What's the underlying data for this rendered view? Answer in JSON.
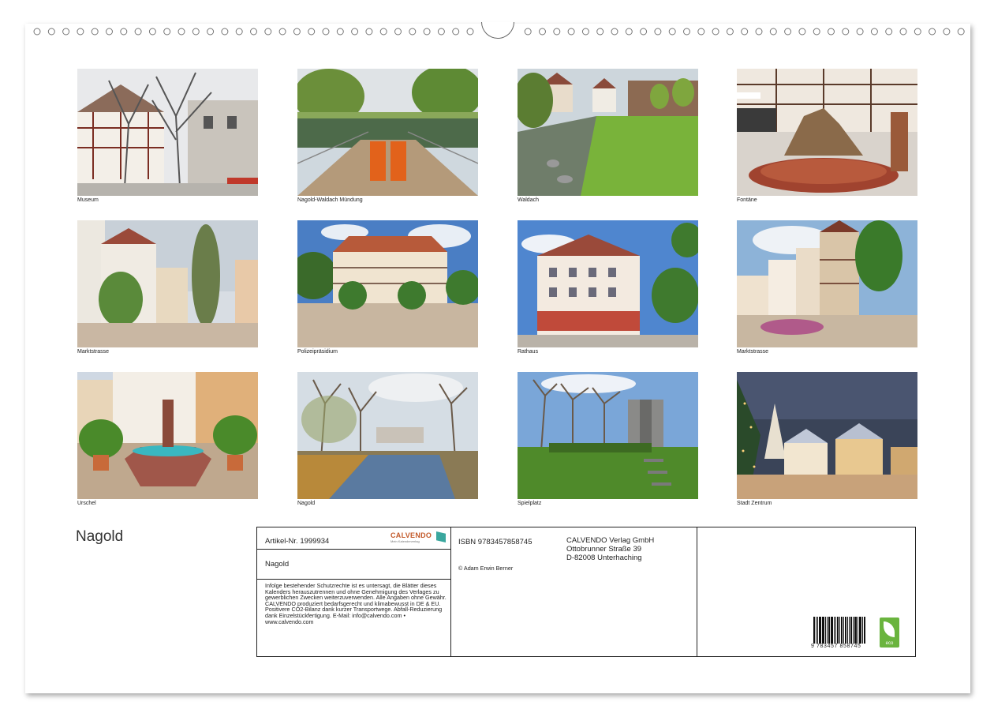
{
  "calendar_title": "Nagold",
  "photos": [
    {
      "caption": "Museum",
      "scene": "halftimbered-winter"
    },
    {
      "caption": "Nagold-Waldach Mündung",
      "scene": "river-bridge"
    },
    {
      "caption": "Waldach",
      "scene": "stream-meadow"
    },
    {
      "caption": "Fontäne",
      "scene": "fountain-square"
    },
    {
      "caption": "Marktstrasse",
      "scene": "street-poplar"
    },
    {
      "caption": "Polizeipräsidium",
      "scene": "big-building-trees"
    },
    {
      "caption": "Rathaus",
      "scene": "townhall"
    },
    {
      "caption": "Marktstrasse",
      "scene": "halftimbered-row"
    },
    {
      "caption": "Urschel",
      "scene": "statue-fountain"
    },
    {
      "caption": "Nagold",
      "scene": "river-autumn"
    },
    {
      "caption": "Spielplatz",
      "scene": "park-tower"
    },
    {
      "caption": "Stadt Zentrum",
      "scene": "night-square"
    }
  ],
  "info_box": {
    "article_label": "Artikel-Nr. 1999934",
    "brand": "CALVENDO",
    "brand_tagline": "Mein Kalenderverlag",
    "title": "Nagold",
    "legal_text": "Infolge bestehender Schutzrechte ist es untersagt, die Blätter dieses Kalenders herauszutrennen und ohne Genehmigung des Verlages zu gewerblichen Zwecken weiterzuverwenden. Alle Angaben ohne Gewähr. CALVENDO produziert bedarfsgerecht und klimabewusst in DE & EU. Positivere CO2-Bilanz dank kurzer Transportwege. Abfall-Reduzierung dank Einzelstückfertigung. E-Mail: info@calvendo.com • www.calvendo.com",
    "isbn": "ISBN 9783457858745",
    "copyright": "© Adam Erwin Berner",
    "publisher_name": "CALVENDO Verlag GmbH",
    "publisher_street": "Ottobrunner Straße 39",
    "publisher_city": "D-82008 Unterhaching",
    "barcode_number": "9 783457 858745",
    "eco_label": "eco"
  }
}
